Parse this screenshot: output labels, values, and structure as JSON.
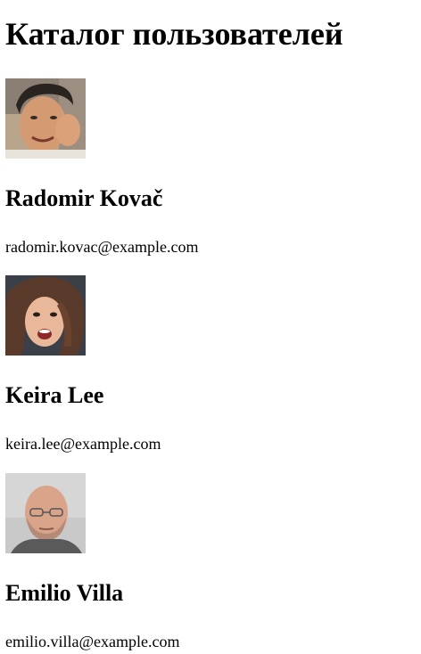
{
  "page": {
    "title": "Каталог пользователей"
  },
  "users": [
    {
      "name": "Radomir Kovač",
      "email": "radomir.kovac@example.com",
      "avatar_icon": "man-with-dark-hair-portrait"
    },
    {
      "name": "Keira Lee",
      "email": "keira.lee@example.com",
      "avatar_icon": "woman-with-brown-hair-portrait"
    },
    {
      "name": "Emilio Villa",
      "email": "emilio.villa@example.com",
      "avatar_icon": "bald-man-with-glasses-portrait"
    }
  ]
}
